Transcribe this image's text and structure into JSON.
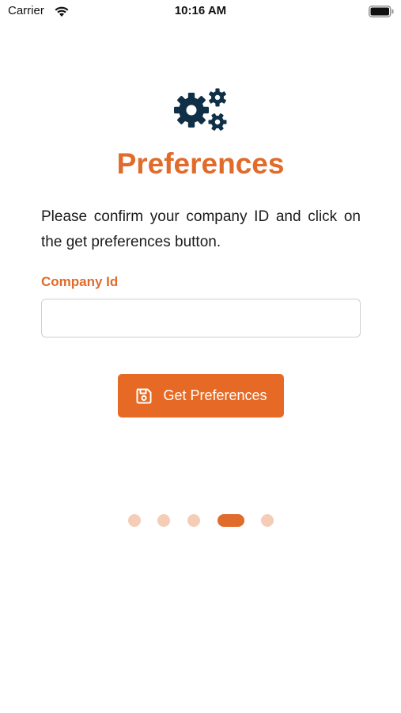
{
  "status_bar": {
    "carrier": "Carrier",
    "time": "10:16 AM",
    "wifi_icon": "wifi-icon",
    "battery_icon": "battery-icon"
  },
  "header": {
    "icon": "gears-icon",
    "title": "Preferences"
  },
  "main": {
    "description": "Please confirm your company ID and click on the get preferences button.",
    "company_field": {
      "label": "Company Id",
      "value": "",
      "placeholder": ""
    },
    "button": {
      "label": "Get Preferences",
      "icon": "floppy-disk-icon"
    }
  },
  "pager": {
    "total": 5,
    "active_index": 3
  },
  "colors": {
    "accent": "#e06b2b",
    "button": "#e66a25",
    "dot_inactive": "#f5cdb6",
    "icon_dark": "#0f3046"
  }
}
